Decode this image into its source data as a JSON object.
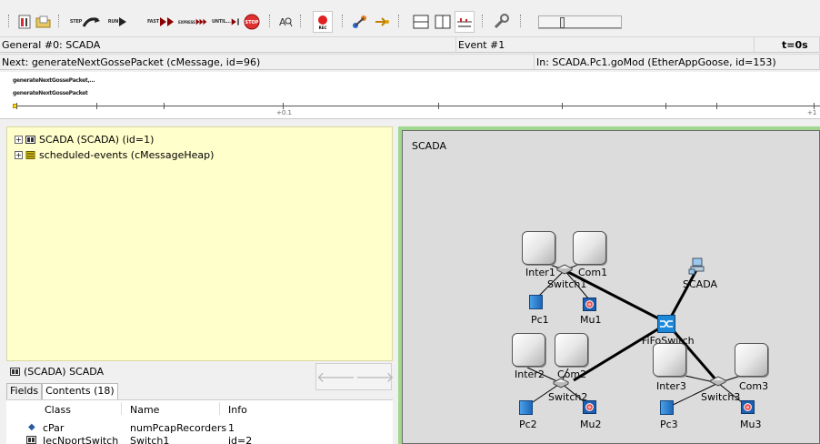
{
  "toolbar": {
    "buttons": [
      {
        "name": "open-ini-icon"
      },
      {
        "name": "open-file-icon"
      },
      {
        "name": "step-button",
        "label": "STEP"
      },
      {
        "name": "run-button",
        "label": "RUN"
      },
      {
        "name": "fast-button",
        "label": "FAST"
      },
      {
        "name": "express-button",
        "label": "EXPRESS"
      },
      {
        "name": "until-button",
        "label": "UNTIL..."
      },
      {
        "name": "stop-button",
        "label": "STOP"
      },
      {
        "name": "find-icon"
      },
      {
        "name": "record-button",
        "label": "REC"
      },
      {
        "name": "object-tree-icon"
      },
      {
        "name": "module-graph-icon"
      },
      {
        "name": "split-horizontal-icon"
      },
      {
        "name": "split-vertical-icon"
      },
      {
        "name": "timeline-icon"
      },
      {
        "name": "preferences-icon"
      }
    ]
  },
  "status": {
    "network": "General #0: SCADA",
    "event": "Event #1",
    "time": "t=0s",
    "next": "Next: generateNextGossePacket (cMessage, id=96)",
    "in": "In: SCADA.Pc1.goMod (EtherAppGoose, id=153)"
  },
  "timeline": {
    "messages": [
      "generateNextGossePacket,...",
      "generateNextGossePacket"
    ],
    "labels": [
      "+0.1",
      "+1"
    ]
  },
  "tree": {
    "items": [
      {
        "label": "SCADA (SCADA) (id=1)"
      },
      {
        "label": "scheduled-events (cMessageHeap)"
      }
    ]
  },
  "inspector": {
    "title": "(SCADA) SCADA",
    "tabs": [
      "Fields",
      "Contents (18)"
    ],
    "columns": [
      "Class",
      "Name",
      "Info"
    ],
    "rows": [
      {
        "class": "cPar",
        "name": "numPcapRecorders",
        "info": "1"
      },
      {
        "class": "IecNportSwitch",
        "name": "Switch1",
        "info": "id=2"
      }
    ]
  },
  "canvas": {
    "title": "SCADA",
    "nodes": [
      "Inter1",
      "Com1",
      "Switch1",
      "Pc1",
      "Mu1",
      "SCADA",
      "FiFoSwitch",
      "Inter2",
      "Com2",
      "Switch2",
      "Pc2",
      "Mu2",
      "Inter3",
      "Com3",
      "Switch3",
      "Pc3",
      "Mu3"
    ]
  }
}
